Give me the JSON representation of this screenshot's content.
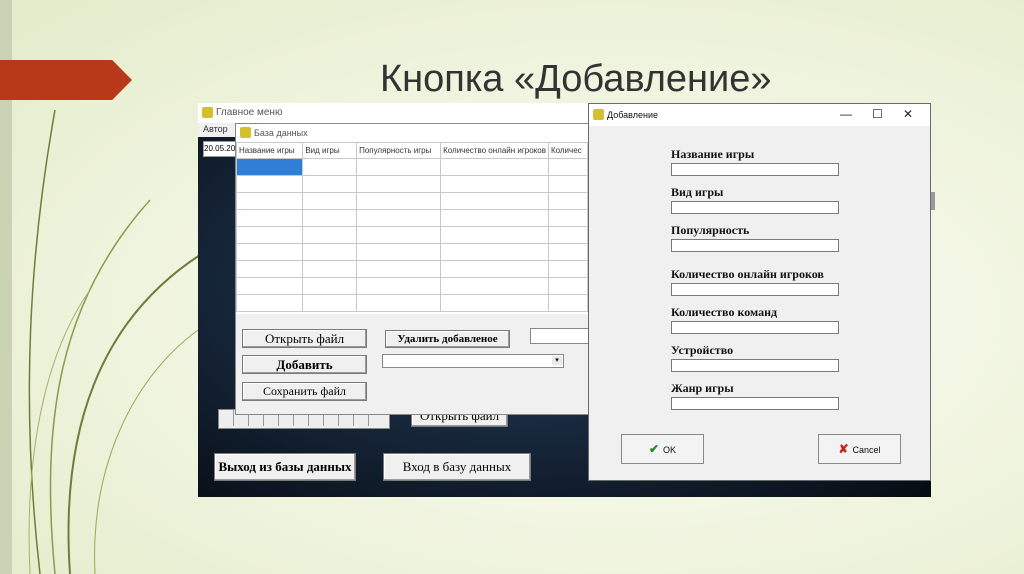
{
  "slide": {
    "title": "Кнопка «Добавление»",
    "accent_color": "#b7391a"
  },
  "main_window": {
    "title": "Главное меню",
    "menu_label": "Автор",
    "date_value": "20.05.20",
    "open_file_label": "Открыть файл",
    "exit_db_label": "Выход из базы данных",
    "enter_db_label": "Вход в базу данных"
  },
  "db_window": {
    "title": "База данных",
    "columns": [
      "Название игры",
      "Вид игры",
      "Популярность игры",
      "Количество онлайн игроков",
      "Количес"
    ],
    "open_file_label": "Открыть файл",
    "delete_added_label": "Удалить добавленое",
    "add_label": "Добавить",
    "save_file_label": "Сохранить файл"
  },
  "add_dialog": {
    "title": "Добавление",
    "minimize_icon": "minimize-icon",
    "maximize_icon": "maximize-icon",
    "close_icon": "close-icon",
    "fields": [
      {
        "label": "Название игры",
        "value": ""
      },
      {
        "label": "Вид игры",
        "value": ""
      },
      {
        "label": "Популярность",
        "value": ""
      },
      {
        "label": "Количество онлайн игроков",
        "value": ""
      },
      {
        "label": "Количество команд",
        "value": ""
      },
      {
        "label": "Устройство",
        "value": ""
      },
      {
        "label": "Жанр игры",
        "value": ""
      }
    ],
    "ok_label": "OK",
    "cancel_label": "Cancel"
  }
}
